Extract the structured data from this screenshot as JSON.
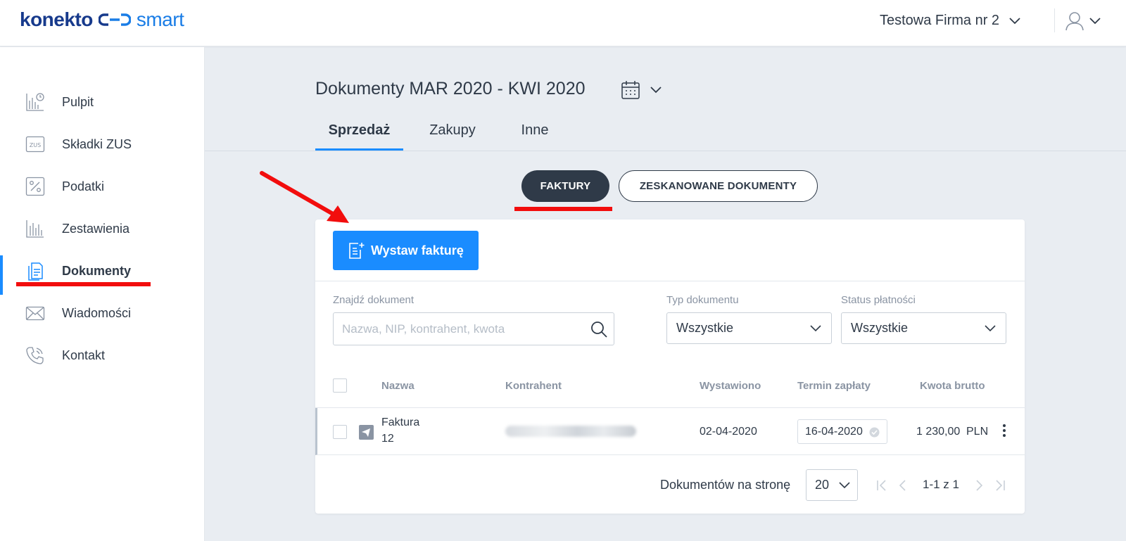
{
  "header": {
    "logo_primary": "konekto",
    "logo_secondary": "smart",
    "company_name": "Testowa Firma nr 2"
  },
  "sidebar": {
    "items": [
      {
        "label": "Pulpit",
        "icon": "dashboard-chart-icon"
      },
      {
        "label": "Składki ZUS",
        "icon": "zus-icon"
      },
      {
        "label": "Podatki",
        "icon": "percent-icon"
      },
      {
        "label": "Zestawienia",
        "icon": "bar-chart-icon"
      },
      {
        "label": "Dokumenty",
        "icon": "documents-icon",
        "active": true
      },
      {
        "label": "Wiadomości",
        "icon": "envelope-icon"
      },
      {
        "label": "Kontakt",
        "icon": "phone-icon"
      }
    ]
  },
  "page": {
    "title": "Dokumenty MAR 2020 - KWI 2020",
    "tabs": [
      "Sprzedaż",
      "Zakupy",
      "Inne"
    ],
    "active_tab": "Sprzedaż"
  },
  "toggles": {
    "invoices": "FAKTURY",
    "scanned": "ZESKANOWANE DOKUMENTY"
  },
  "actions": {
    "issue_invoice": "Wystaw fakturę"
  },
  "filters": {
    "search_label": "Znajdź dokument",
    "search_placeholder": "Nazwa, NIP, kontrahent, kwota",
    "doc_type_label": "Typ dokumentu",
    "doc_type_value": "Wszystkie",
    "payment_status_label": "Status płatności",
    "payment_status_value": "Wszystkie"
  },
  "table": {
    "columns": [
      "Nazwa",
      "Kontrahent",
      "Wystawiono",
      "Termin zapłaty",
      "Kwota brutto"
    ],
    "rows": [
      {
        "name_line1": "Faktura",
        "name_line2": "12",
        "issued": "02-04-2020",
        "due": "16-04-2020",
        "amount": "1 230,00",
        "currency": "PLN"
      }
    ]
  },
  "pagination": {
    "per_page_label": "Dokumentów na stronę",
    "per_page_value": "20",
    "range": "1-1 z 1"
  },
  "colors": {
    "accent": "#1a8cff",
    "dark": "#2f3a48",
    "annotation": "#f20d0d"
  }
}
